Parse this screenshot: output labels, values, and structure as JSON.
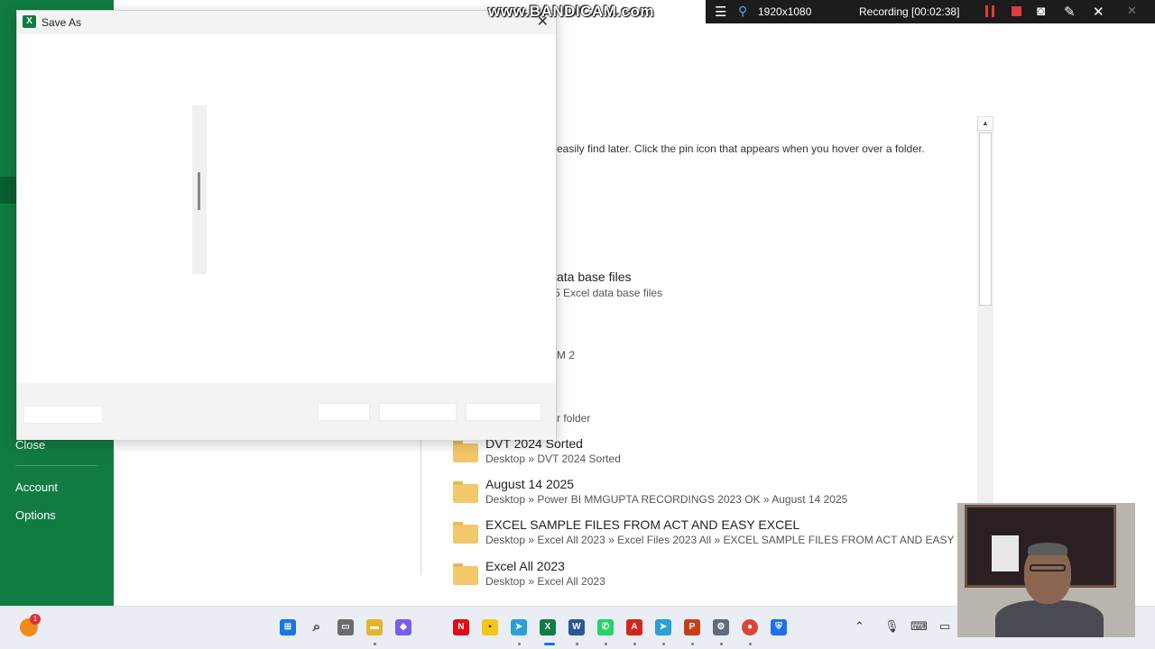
{
  "backstage": {
    "nav": {
      "close": "Close",
      "account": "Account",
      "options": "Options"
    },
    "hint_text": "easily find later. Click the pin icon that appears when you hover over a folder.",
    "partial": {
      "p1_title": "ata base files",
      "p1_sub": "5 Excel data base files",
      "p2_sub": "M 2",
      "p3_sub": "r folder"
    },
    "folders": [
      {
        "name": "DVT 2024 Sorted",
        "path": "Desktop » DVT 2024 Sorted"
      },
      {
        "name": "August 14  2025",
        "path": "Desktop » Power BI MMGUPTA RECORDINGS 2023 OK » August 14  2025"
      },
      {
        "name": "EXCEL SAMPLE FILES FROM ACT AND EASY EXCEL",
        "path": "Desktop » Excel All 2023 » Excel Files 2023 All » EXCEL SAMPLE FILES FROM ACT AND EASY E..."
      },
      {
        "name": "Excel All 2023",
        "path": "Desktop » Excel All 2023"
      }
    ]
  },
  "dialog": {
    "title": "Save As",
    "app_icon": "X",
    "close_glyph": "✕"
  },
  "recorder": {
    "watermark": "www.BANDICAM.com",
    "resolution": "1920x1080",
    "status": "Recording [00:02:38]",
    "icons": [
      "menu-icon",
      "pin-icon",
      "pause-icon",
      "stop-icon",
      "camera-icon",
      "pencil-icon",
      "close-icon"
    ]
  },
  "taskbar": {
    "weather_badge": "1",
    "apps": [
      {
        "name": "start",
        "color": "#1a73e8",
        "glyph": "⊞"
      },
      {
        "name": "search",
        "color": "#444444",
        "glyph": "⌕"
      },
      {
        "name": "task-view",
        "color": "#555555",
        "glyph": "▭"
      },
      {
        "name": "file-explorer",
        "color": "#e8b22a",
        "glyph": "▬"
      },
      {
        "name": "copilot",
        "color": "#7a5cf0",
        "glyph": "◆"
      },
      {
        "name": "netflix",
        "color": "#e50914",
        "glyph": "N"
      },
      {
        "name": "sticky-notes",
        "color": "#f5c518",
        "glyph": "▪"
      },
      {
        "name": "telegram",
        "color": "#2a9fd8",
        "glyph": "➤"
      },
      {
        "name": "excel",
        "color": "#107c41",
        "glyph": "X"
      },
      {
        "name": "word",
        "color": "#2b579a",
        "glyph": "W"
      },
      {
        "name": "whatsapp",
        "color": "#25d366",
        "glyph": "✆"
      },
      {
        "name": "acrobat",
        "color": "#d4251c",
        "glyph": "A"
      },
      {
        "name": "telegram-2",
        "color": "#2a9fd8",
        "glyph": "➤"
      },
      {
        "name": "powerpoint",
        "color": "#c43e1c",
        "glyph": "P"
      },
      {
        "name": "settings",
        "color": "#5f6b7a",
        "glyph": "⚙"
      },
      {
        "name": "chrome",
        "color": "#db4437",
        "glyph": "●"
      },
      {
        "name": "defender",
        "color": "#1a73e8",
        "glyph": "⛨"
      }
    ],
    "tray": [
      "chevron-up-icon",
      "microphone-icon",
      "keyboard-icon",
      "display-icon"
    ]
  }
}
